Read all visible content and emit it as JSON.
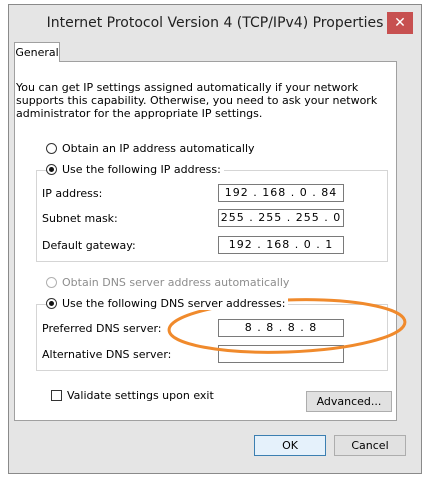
{
  "window": {
    "title": "Internet Protocol Version 4 (TCP/IPv4) Properties",
    "close_glyph": "✕"
  },
  "tabs": [
    {
      "label": "General"
    }
  ],
  "description": "You can get IP settings assigned automatically if your network supports this capability. Otherwise, you need to ask your network administrator for the appropriate IP settings.",
  "ip": {
    "auto_label": "Obtain an IP address automatically",
    "manual_label": "Use the following IP address:",
    "selected": "manual",
    "fields": [
      {
        "label": "IP address:",
        "value": "192 . 168 . 0 . 84"
      },
      {
        "label": "Subnet mask:",
        "value": "255 . 255 . 255 . 0"
      },
      {
        "label": "Default gateway:",
        "value": "192 . 168 . 0 . 1"
      }
    ]
  },
  "dns": {
    "auto_label": "Obtain DNS server address automatically",
    "manual_label": "Use the following DNS server addresses:",
    "selected": "manual",
    "fields": [
      {
        "label": "Preferred DNS server:",
        "value": "8 . 8 . 8 . 8"
      },
      {
        "label": "Alternative DNS server:",
        "value": ""
      }
    ]
  },
  "validate": {
    "label": "Validate settings upon exit",
    "checked": false
  },
  "buttons": {
    "advanced": "Advanced...",
    "ok": "OK",
    "cancel": "Cancel"
  },
  "annotation": {
    "color": "#f08a2c"
  }
}
